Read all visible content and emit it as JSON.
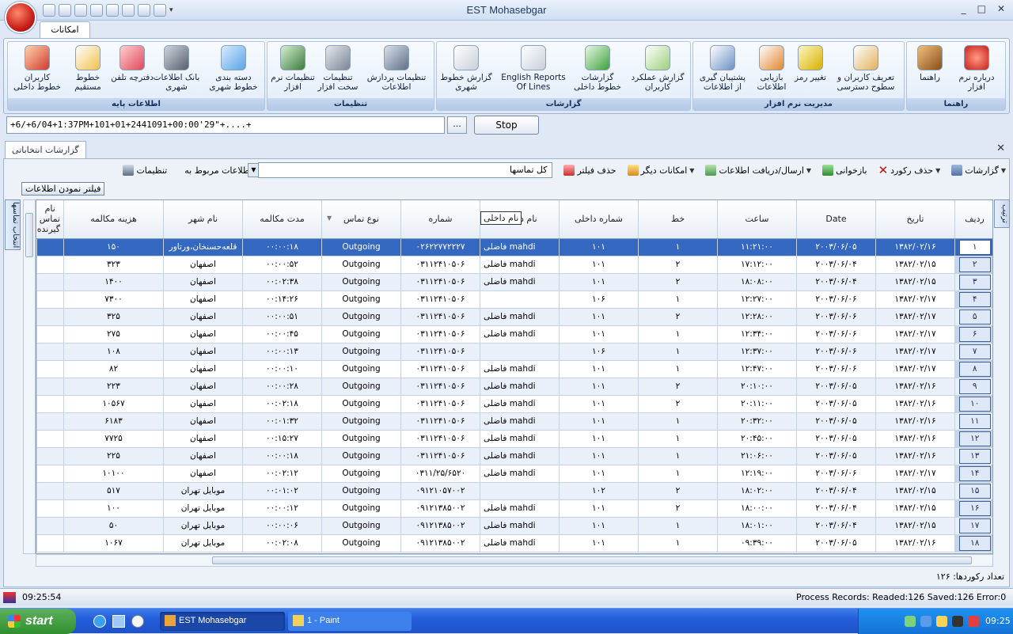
{
  "window": {
    "title": "EST Mohasebgar",
    "minimize": "_",
    "maximize": "□",
    "close": "✕"
  },
  "ribbon": {
    "tab": "امکانات",
    "groups": [
      {
        "title": "اطلاعات پایه",
        "items": [
          "کاربران خطوط داخلی",
          "خطوط مستقیم",
          "دفترچه تلفن",
          "بانک اطلاعات شهری",
          "دسته بندی خطوط شهری"
        ]
      },
      {
        "title": "تنظیمات",
        "items": [
          "تنظیمات نرم افزار",
          "تنظیمات سخت افزار",
          "تنظیمات پردازش اطلاعات"
        ]
      },
      {
        "title": "گزارشات",
        "items": [
          "گزارش خطوط شهری",
          "English Reports Of Lines",
          "گزارشات خطوط داخلی",
          "گزارش عملکرد کاربران"
        ]
      },
      {
        "title": "مدیریت نرم افزار",
        "items": [
          "پشتیبان گیری از اطلاعات",
          "بازیابی اطلاعات",
          "تغییر رمز",
          "تعریف کاربران و سطوح دسترسی"
        ]
      },
      {
        "title": "راهنما",
        "items": [
          "راهنما",
          "درباره نرم افزار"
        ]
      }
    ]
  },
  "command": {
    "value": "+6/+6/04+1:37PM+101+01+2441091+00:00'29\"+....+",
    "browse_label": "...",
    "stop_label": "Stop"
  },
  "document": {
    "tab_label": "گزارشات انتخاباتی",
    "close": "✕"
  },
  "toolbar": {
    "reports": "گزارشات",
    "delete_record": "حذف رکورد",
    "refresh": "بازخوانی",
    "send_receive": "ارسال/دریافت اطلاعات",
    "more": "امکانات دیگر",
    "remove_filter": "حذف فیلتر",
    "related_label": "اطلاعات مربوط به:",
    "related_value": "کل تماسها",
    "settings": "تنظیمات"
  },
  "filter_button": "فیلتر نمودن اطلاعات",
  "side_tabs": {
    "left": "انتخاب تماسها",
    "right": "ترتیب"
  },
  "grid": {
    "columns": [
      "ردیف",
      "تاریخ",
      "Date",
      "ساعت",
      "خط",
      "شماره داخلی",
      "نام داخلی",
      "شماره",
      "نوع تماس",
      "مدت مکالمه",
      "نام شهر",
      "هزینه مکالمه",
      "نام تماس گیرنده"
    ],
    "header_tooltip": "نام داخلی",
    "rows": [
      [
        "۱",
        "۱۳۸۲/۰۲/۱۶",
        "۲۰۰۳/۰۶/۰۵",
        "۱۱:۲۱:۰۰",
        "۱",
        "۱۰۱",
        "mahdi فاضلی",
        "۰۲۶۲۲۷۷۲۲۲۷",
        "Outgoing",
        "۰۰:۰۰:۱۸",
        "قلعه‌حسنخان،ورتاور",
        "۱۵۰",
        ""
      ],
      [
        "۲",
        "۱۳۸۲/۰۲/۱۵",
        "۲۰۰۳/۰۶/۰۴",
        "۱۷:۱۲:۰۰",
        "۲",
        "۱۰۱",
        "mahdi فاضلی",
        "۰۳۱۱۲۴۱۰۵۰۶",
        "Outgoing",
        "۰۰:۰۰:۵۲",
        "اصفهان",
        "۳۲۳",
        ""
      ],
      [
        "۳",
        "۱۳۸۲/۰۲/۱۵",
        "۲۰۰۳/۰۶/۰۴",
        "۱۸:۰۸:۰۰",
        "۲",
        "۱۰۱",
        "mahdi فاضلی",
        "۰۳۱۱۲۴۱۰۵۰۶",
        "Outgoing",
        "۰۰:۰۲:۳۸",
        "اصفهان",
        "۱۴۰۰",
        ""
      ],
      [
        "۴",
        "۱۳۸۲/۰۲/۱۷",
        "۲۰۰۳/۰۶/۰۶",
        "۱۲:۲۷:۰۰",
        "۱",
        "۱۰۶",
        "",
        "۰۳۱۱۲۴۱۰۵۰۶",
        "Outgoing",
        "۰۰:۱۴:۲۶",
        "اصفهان",
        "۷۳۰۰",
        ""
      ],
      [
        "۵",
        "۱۳۸۲/۰۲/۱۷",
        "۲۰۰۳/۰۶/۰۶",
        "۱۲:۲۸:۰۰",
        "۲",
        "۱۰۱",
        "mahdi فاضلی",
        "۰۳۱۱۲۴۱۰۵۰۶",
        "Outgoing",
        "۰۰:۰۰:۵۱",
        "اصفهان",
        "۳۲۵",
        ""
      ],
      [
        "۶",
        "۱۳۸۲/۰۲/۱۷",
        "۲۰۰۳/۰۶/۰۶",
        "۱۲:۳۴:۰۰",
        "۱",
        "۱۰۱",
        "mahdi فاضلی",
        "۰۳۱۱۲۴۱۰۵۰۶",
        "Outgoing",
        "۰۰:۰۰:۴۵",
        "اصفهان",
        "۲۷۵",
        ""
      ],
      [
        "۷",
        "۱۳۸۲/۰۲/۱۷",
        "۲۰۰۳/۰۶/۰۶",
        "۱۲:۳۷:۰۰",
        "۱",
        "۱۰۶",
        "",
        "۰۳۱۱۲۴۱۰۵۰۶",
        "Outgoing",
        "۰۰:۰۰:۱۳",
        "اصفهان",
        "۱۰۸",
        ""
      ],
      [
        "۸",
        "۱۳۸۲/۰۲/۱۷",
        "۲۰۰۳/۰۶/۰۶",
        "۱۲:۴۷:۰۰",
        "۱",
        "۱۰۱",
        "mahdi فاضلی",
        "۰۳۱۱۲۴۱۰۵۰۶",
        "Outgoing",
        "۰۰:۰۰:۱۰",
        "اصفهان",
        "۸۲",
        ""
      ],
      [
        "۹",
        "۱۳۸۲/۰۲/۱۶",
        "۲۰۰۳/۰۶/۰۵",
        "۲۰:۱۰:۰۰",
        "۲",
        "۱۰۱",
        "mahdi فاضلی",
        "۰۳۱۱۲۴۱۰۵۰۶",
        "Outgoing",
        "۰۰:۰۰:۲۸",
        "اصفهان",
        "۲۲۳",
        ""
      ],
      [
        "۱۰",
        "۱۳۸۲/۰۲/۱۶",
        "۲۰۰۳/۰۶/۰۵",
        "۲۰:۱۱:۰۰",
        "۲",
        "۱۰۱",
        "mahdi فاضلی",
        "۰۳۱۱۲۴۱۰۵۰۶",
        "Outgoing",
        "۰۰:۰۲:۱۸",
        "اصفهان",
        "۱۰۵۶۷",
        ""
      ],
      [
        "۱۱",
        "۱۳۸۲/۰۲/۱۶",
        "۲۰۰۳/۰۶/۰۵",
        "۲۰:۳۲:۰۰",
        "۱",
        "۱۰۱",
        "mahdi فاضلی",
        "۰۳۱۱۲۴۱۰۵۰۶",
        "Outgoing",
        "۰۰:۰۱:۳۲",
        "اصفهان",
        "۶۱۸۳",
        ""
      ],
      [
        "۱۲",
        "۱۳۸۲/۰۲/۱۶",
        "۲۰۰۳/۰۶/۰۵",
        "۲۰:۴۵:۰۰",
        "۱",
        "۱۰۱",
        "mahdi فاضلی",
        "۰۳۱۱۲۴۱۰۵۰۶",
        "Outgoing",
        "۰۰:۱۵:۲۷",
        "اصفهان",
        "۷۷۲۵",
        ""
      ],
      [
        "۱۳",
        "۱۳۸۲/۰۲/۱۶",
        "۲۰۰۳/۰۶/۰۵",
        "۲۱:۰۶:۰۰",
        "۱",
        "۱۰۱",
        "mahdi فاضلی",
        "۰۳۱۱۲۴۱۰۵۰۶",
        "Outgoing",
        "۰۰:۰۰:۱۸",
        "اصفهان",
        "۲۲۵",
        ""
      ],
      [
        "۱۴",
        "۱۳۸۲/۰۲/۱۷",
        "۲۰۰۳/۰۶/۰۶",
        "۱۲:۱۹:۰۰",
        "۱",
        "۱۰۱",
        "mahdi فاضلی",
        "۰۳۱۱/۲۵/۶۵۲۰",
        "Outgoing",
        "۰۰:۰۲:۱۲",
        "اصفهان",
        "۱۰۱۰۰",
        ""
      ],
      [
        "۱۵",
        "۱۳۸۲/۰۲/۱۵",
        "۲۰۰۳/۰۶/۰۴",
        "۱۸:۰۲:۰۰",
        "۲",
        "۱۰۲",
        "",
        "۰۹۱۲۱۰۵۷۰۰۲",
        "Outgoing",
        "۰۰:۰۱:۰۲",
        "موبایل تهران",
        "۵۱۷",
        ""
      ],
      [
        "۱۶",
        "۱۳۸۲/۰۲/۱۵",
        "۲۰۰۳/۰۶/۰۴",
        "۱۸:۰۰:۰۰",
        "۲",
        "۱۰۱",
        "mahdi فاضلی",
        "۰۹۱۲۱۳۸۵۰۰۲",
        "Outgoing",
        "۰۰:۰۰:۱۲",
        "موبایل تهران",
        "۱۰۰",
        ""
      ],
      [
        "۱۷",
        "۱۳۸۲/۰۲/۱۵",
        "۲۰۰۳/۰۶/۰۴",
        "۱۸:۰۱:۰۰",
        "۱",
        "۱۰۱",
        "mahdi فاضلی",
        "۰۹۱۲۱۳۸۵۰۰۲",
        "Outgoing",
        "۰۰:۰۰:۰۶",
        "موبایل تهران",
        "۵۰",
        ""
      ],
      [
        "۱۸",
        "۱۳۸۲/۰۲/۱۶",
        "۲۰۰۳/۰۶/۰۵",
        "۰۹:۳۹:۰۰",
        "۱",
        "۱۰۱",
        "mahdi فاضلی",
        "۰۹۱۲۱۳۸۵۰۰۲",
        "Outgoing",
        "۰۰:۰۲:۰۸",
        "موبایل تهران",
        "۱۰۶۷",
        ""
      ]
    ]
  },
  "record_count": "تعداد رکوردها: ۱۲۶",
  "status": {
    "time": "09:25:54",
    "process": "Process Records: Readed:126 Saved:126 Error:0"
  },
  "taskbar": {
    "start": "start",
    "tasks": [
      "EST Mohasebgar",
      "1 - Paint"
    ],
    "lang": "FA",
    "clock": "09:25"
  }
}
